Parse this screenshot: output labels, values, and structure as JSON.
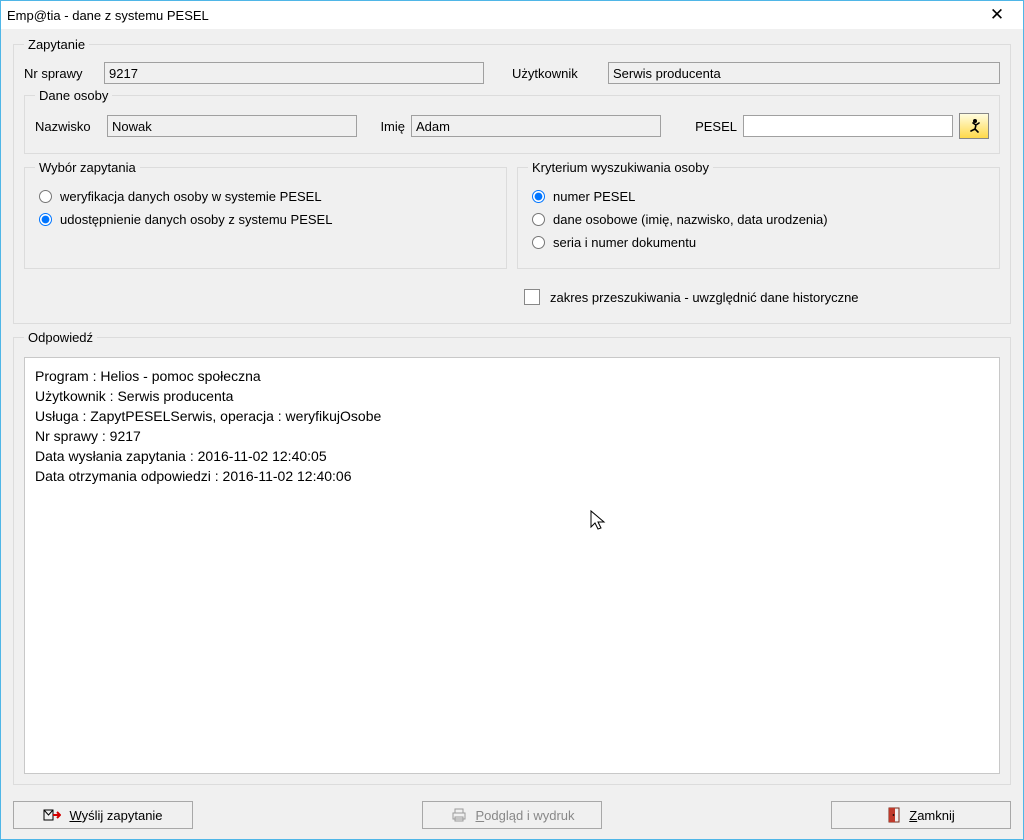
{
  "window": {
    "title": "Emp@tia - dane z systemu PESEL"
  },
  "zapytanie": {
    "legend": "Zapytanie",
    "nr_sprawy_label": "Nr sprawy",
    "nr_sprawy_value": "9217",
    "uzytkownik_label": "Użytkownik",
    "uzytkownik_value": "Serwis producenta"
  },
  "dane_osoby": {
    "legend": "Dane osoby",
    "nazwisko_label": "Nazwisko",
    "nazwisko_value": "Nowak",
    "imie_label": "Imię",
    "imie_value": "Adam",
    "pesel_label": "PESEL",
    "pesel_value": ""
  },
  "wybor": {
    "legend": "Wybór zapytania",
    "opt1": "weryfikacja danych osoby w systemie PESEL",
    "opt2": "udostępnienie danych osoby z systemu PESEL"
  },
  "kryterium": {
    "legend": "Kryterium wyszukiwania osoby",
    "opt1": "numer PESEL",
    "opt2": "dane osobowe (imię, nazwisko, data urodzenia)",
    "opt3": "seria i numer dokumentu"
  },
  "zakres_label": "zakres przeszukiwania - uwzględnić dane historyczne",
  "odpowiedz": {
    "legend": "Odpowiedź",
    "text": "Program : Helios - pomoc społeczna\nUżytkownik : Serwis producenta\nUsługa : ZapytPESELSerwis, operacja : weryfikujOsobe\nNr sprawy : 9217\nData wysłania zapytania : 2016-11-02 12:40:05\nData otrzymania odpowiedzi : 2016-11-02 12:40:06"
  },
  "buttons": {
    "wyslij": "Wyślij zapytanie",
    "podglad": "Podgląd i wydruk",
    "zamknij": "Zamknij"
  }
}
